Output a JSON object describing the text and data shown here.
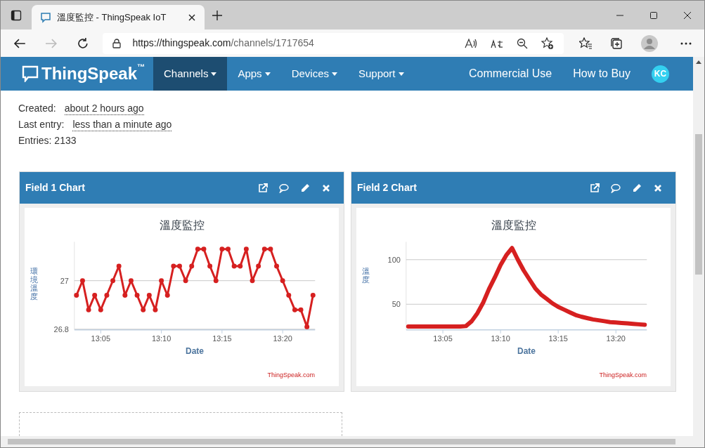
{
  "browser": {
    "tab_title": "溫度監控 - ThingSpeak IoT",
    "url_host": "https://thingspeak.com",
    "url_path": "/channels/1717654"
  },
  "navbar": {
    "brand": "ThingSpeak",
    "brand_mark": "™",
    "menu": [
      {
        "label": "Channels",
        "selected": true,
        "dropdown": true
      },
      {
        "label": "Apps",
        "selected": false,
        "dropdown": true
      },
      {
        "label": "Devices",
        "selected": false,
        "dropdown": true
      },
      {
        "label": "Support",
        "selected": false,
        "dropdown": true
      }
    ],
    "links": [
      "Commercial Use",
      "How to Buy"
    ],
    "avatar": "KC"
  },
  "info": [
    {
      "label": "Created:",
      "value": "about 2 hours ago"
    },
    {
      "label": "Last entry:",
      "value": "less than a minute ago"
    },
    {
      "label": "Entries: 2133"
    }
  ],
  "cards": [
    {
      "title": "Field 1 Chart",
      "credit": "ThingSpeak.com",
      "chart_data": {
        "type": "line",
        "title": "溫度監控",
        "xlabel": "Date",
        "ylabel": "環境溫度",
        "ylim": [
          26.8,
          27.16
        ],
        "yticks": [
          26.8,
          27
        ],
        "categories": [
          null,
          null,
          null,
          null,
          "13:05",
          null,
          null,
          null,
          null,
          null,
          null,
          null,
          null,
          null,
          "13:10",
          null,
          null,
          null,
          null,
          null,
          null,
          null,
          null,
          null,
          "13:15",
          null,
          null,
          null,
          null,
          null,
          null,
          null,
          null,
          null,
          "13:20",
          null,
          null,
          null,
          null,
          null
        ],
        "series": [
          {
            "color": "#d62020",
            "marker": "circle",
            "values": [
              26.94,
              27.0,
              26.88,
              26.94,
              26.88,
              26.94,
              27.0,
              27.06,
              26.94,
              27.0,
              26.94,
              26.88,
              26.94,
              26.88,
              27.0,
              26.94,
              27.06,
              27.06,
              27.0,
              27.06,
              27.13,
              27.13,
              27.06,
              27.0,
              27.13,
              27.13,
              27.06,
              27.06,
              27.13,
              27.0,
              27.06,
              27.13,
              27.13,
              27.06,
              27.0,
              26.94,
              26.88,
              26.88,
              26.81,
              26.94
            ]
          }
        ]
      }
    },
    {
      "title": "Field 2 Chart",
      "credit": "ThingSpeak.com",
      "chart_data": {
        "type": "line",
        "title": "溫度監控",
        "xlabel": "Date",
        "ylabel": "溫度",
        "ylim": [
          22,
          120
        ],
        "yticks": [
          50,
          100
        ],
        "categories": [
          null,
          null,
          null,
          null,
          null,
          null,
          "13:05",
          null,
          null,
          null,
          null,
          null,
          null,
          null,
          null,
          null,
          "13:10",
          null,
          null,
          null,
          null,
          null,
          null,
          null,
          null,
          null,
          "13:15",
          null,
          null,
          null,
          null,
          null,
          null,
          null,
          null,
          null,
          "13:20",
          null,
          null,
          null,
          null,
          null
        ],
        "series": [
          {
            "color": "#d62020",
            "marker": "none",
            "values": [
              25,
              25,
              25,
              25,
              25,
              25,
              25,
              25,
              25,
              25,
              25.5,
              31,
              40,
              52,
              67,
              80,
              94,
              105,
              113,
              100,
              88,
              78,
              68,
              61,
              56,
              51,
              47,
              44,
              41,
              38,
              36,
              34.5,
              33,
              32,
              31,
              30,
              29.5,
              29,
              28.5,
              28,
              27.5,
              27
            ]
          }
        ]
      }
    }
  ]
}
